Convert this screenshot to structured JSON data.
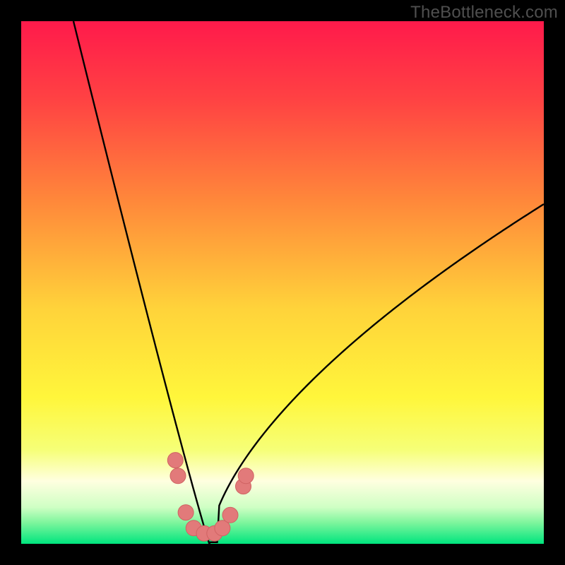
{
  "watermark": "TheBottleneck.com",
  "colors": {
    "frame": "#000000",
    "curve": "#000000",
    "marker_fill": "#e27a7a",
    "marker_stroke": "#cf6262"
  },
  "chart_data": {
    "type": "line",
    "title": "",
    "xlabel": "",
    "ylabel": "",
    "xlim": [
      0,
      100
    ],
    "ylim": [
      0,
      100
    ],
    "grid": false,
    "background": {
      "kind": "vertical-gradient",
      "stops": [
        {
          "t": 0.0,
          "color": "#ff1a4b"
        },
        {
          "t": 0.15,
          "color": "#ff4243"
        },
        {
          "t": 0.35,
          "color": "#ff8a3a"
        },
        {
          "t": 0.55,
          "color": "#ffd33a"
        },
        {
          "t": 0.72,
          "color": "#fff63b"
        },
        {
          "t": 0.82,
          "color": "#f6ff77"
        },
        {
          "t": 0.88,
          "color": "#ffffe0"
        },
        {
          "t": 0.93,
          "color": "#cfffc4"
        },
        {
          "t": 0.96,
          "color": "#7cf59c"
        },
        {
          "t": 1.0,
          "color": "#00e57e"
        }
      ]
    },
    "series": [
      {
        "name": "bottleneck-curve",
        "kind": "v-curve",
        "vertex_x": 36,
        "left_x0": 10,
        "right_x1": 100,
        "right_y_at_x1": 65
      }
    ],
    "markers": [
      {
        "x": 29.5,
        "y": 16
      },
      {
        "x": 30.0,
        "y": 13
      },
      {
        "x": 31.5,
        "y": 6
      },
      {
        "x": 33.0,
        "y": 3
      },
      {
        "x": 35.0,
        "y": 2
      },
      {
        "x": 37.0,
        "y": 2
      },
      {
        "x": 38.5,
        "y": 3
      },
      {
        "x": 40.0,
        "y": 5.5
      },
      {
        "x": 42.5,
        "y": 11
      },
      {
        "x": 43.0,
        "y": 13
      }
    ]
  }
}
